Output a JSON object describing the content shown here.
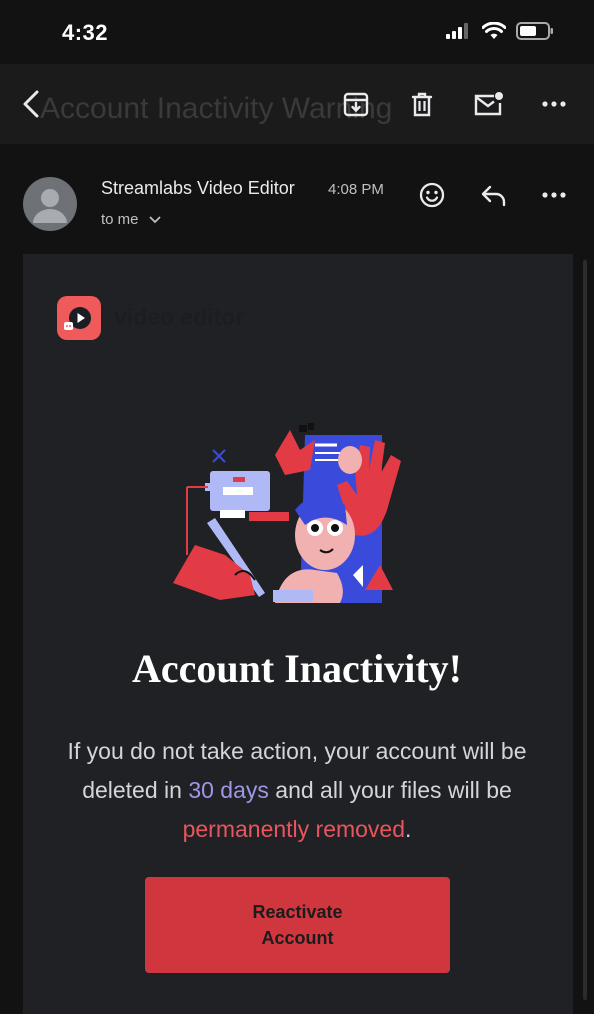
{
  "status_bar": {
    "time": "4:32",
    "icons": [
      "signal-icon",
      "wifi-icon",
      "battery-icon"
    ]
  },
  "header": {
    "subject": "Account Inactivity Warning",
    "actions": [
      "archive-icon",
      "trash-icon",
      "mark-unread-icon",
      "more-icon"
    ]
  },
  "sender": {
    "name": "Streamlabs Video Editor",
    "time": "4:08 PM",
    "to": "to me"
  },
  "email": {
    "logo_text": "video editor",
    "headline": "Account Inactivity!",
    "body_part1": "If you do not take action, your account will be deleted in ",
    "body_highlight_days": "30 days",
    "body_part2": " and all your files will be ",
    "body_highlight_removed": "permanently removed",
    "body_part3": ".",
    "cta_label": "Reactivate Account"
  },
  "colors": {
    "accent_red": "#d0363e",
    "highlight_blue": "#9d97e6",
    "highlight_red": "#e9555e",
    "card_bg": "#202124"
  }
}
